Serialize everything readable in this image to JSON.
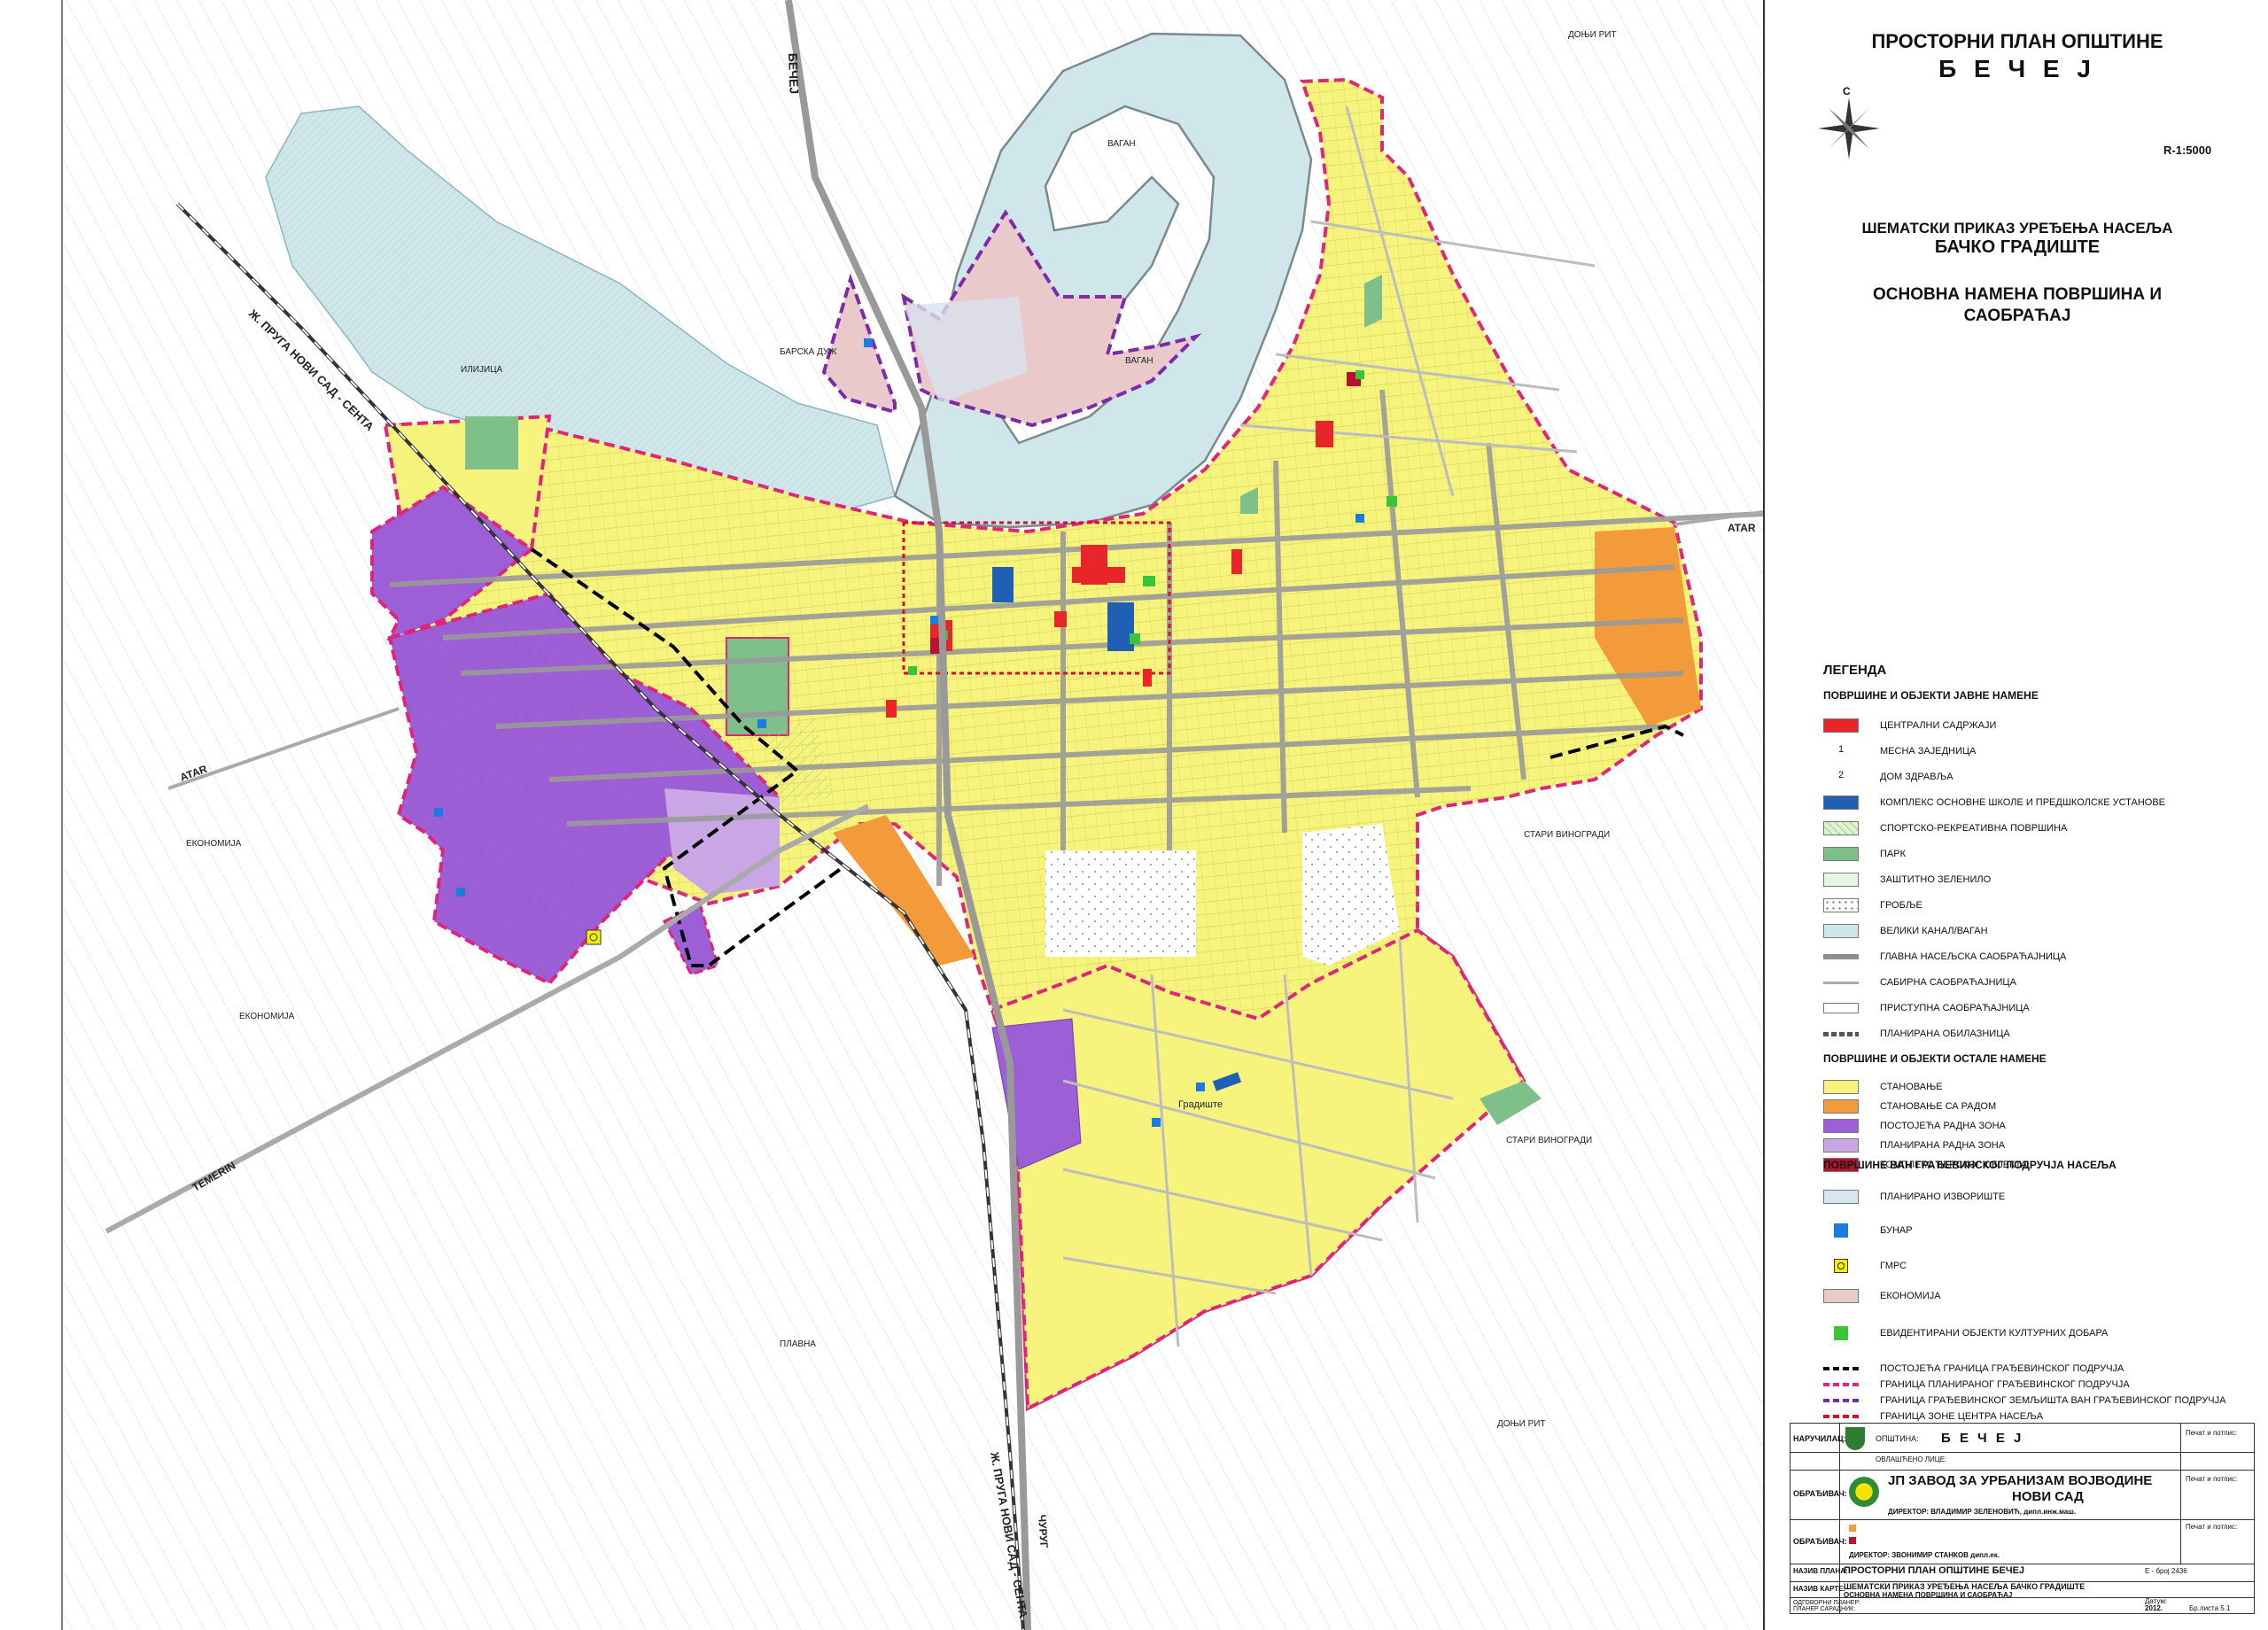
{
  "title": {
    "line1": "ПРОСТОРНИ ПЛАН ОПШТИНЕ",
    "line2": "Б Е Ч Е Ј",
    "north": "С",
    "scale": "R-1:5000",
    "subtitle1": "ШЕМАТСКИ ПРИКАЗ УРЕЂЕЊА НАСЕЉА",
    "subtitle2": "БАЧКО ГРАДИШТЕ",
    "subtitle3": "ОСНОВНА НАМЕНА ПОВРШИНА И",
    "subtitle4": "САОБРАЋАЈ"
  },
  "legend": {
    "heading": "ЛЕГЕНДА",
    "section1": "ПОВРШИНЕ И ОБЈЕКТИ ЈАВНЕ НАМЕНЕ",
    "section2": "ПОВРШИНЕ И ОБЈЕКТИ ОСТАЛЕ НАМЕНЕ",
    "section3": "ПОВРШИНЕ ВАН ГРАЂЕВИНСКОГ ПОДРУЧЈА НАСЕЉА",
    "items_public": [
      {
        "label": "ЦЕНТРАЛНИ САДРЖАЈИ",
        "color": "#e8262a",
        "kind": "fill"
      },
      {
        "label": "МЕСНА ЗАЈЕДНИЦА",
        "marker": "1",
        "kind": "num"
      },
      {
        "label": "ДОМ ЗДРАВЉА",
        "marker": "2",
        "kind": "num"
      },
      {
        "label": "КОМПЛЕКС ОСНОВНЕ ШКОЛЕ И ПРЕДШКОЛСКЕ УСТАНОВЕ",
        "color": "#1f5fb4",
        "kind": "fill"
      },
      {
        "label": "СПОРТСКО-РЕКРЕАТИВНА ПОВРШИНА",
        "color": "#dff3d0",
        "kind": "hatch"
      },
      {
        "label": "ПАРК",
        "color": "#7fbf8a",
        "kind": "fill"
      },
      {
        "label": "ЗАШТИТНО ЗЕЛЕНИЛО",
        "color": "#eaf4e6",
        "kind": "fill"
      },
      {
        "label": "ГРОБЉЕ",
        "color": "#ffffff",
        "kind": "dots"
      },
      {
        "label": "ВЕЛИКИ КАНАЛ/ВАГАН",
        "color": "#cfe6ea",
        "kind": "fill"
      },
      {
        "label": "ГЛАВНА НАСЕЉСКА САОБРАЋАЈНИЦА",
        "kind": "line-thick"
      },
      {
        "label": "САБИРНА САОБРАЋАЈНИЦА",
        "kind": "line-mid"
      },
      {
        "label": "ПРИСТУПНА САОБРАЋАЈНИЦА",
        "kind": "line-thin"
      },
      {
        "label": "ПЛАНИРАНА ОБИЛАЗНИЦА",
        "kind": "line-dash"
      }
    ],
    "items_other": [
      {
        "label": "СТАНОВАЊЕ",
        "color": "#f7f47e"
      },
      {
        "label": "СТАНОВАЊЕ СА РАДОМ",
        "color": "#f39b3a"
      },
      {
        "label": "ПОСТОЈЕЋА РАДНА ЗОНА",
        "color": "#9d5fd6"
      },
      {
        "label": "ПЛАНИРАНА РАДНА ЗОНА",
        "color": "#c9a6e4"
      },
      {
        "label": "КОМПЛЕКС ВЕРСКОГ ОБЈЕКТА",
        "color": "#b5122f"
      }
    ],
    "items_outside": [
      {
        "label": "ПЛАНИРАНО ИЗВОРИШТЕ",
        "color": "#d7e7ef",
        "kind": "fill"
      },
      {
        "label": "БУНАР",
        "color": "#1a7be0",
        "kind": "square"
      },
      {
        "label": "ГМРС",
        "color": "#f5f000",
        "kind": "gmrs"
      },
      {
        "label": "ЕКОНОМИЈА",
        "color": "#e9c9c9",
        "kind": "fill"
      },
      {
        "label": "ЕВИДЕНТИРАНИ ОБЈЕКТИ КУЛТУРНИХ ДОБАРА",
        "color": "#3ac43a",
        "kind": "square"
      }
    ],
    "items_bounds": [
      {
        "label": "ПОСТОЈЕЋА ГРАНИЦА ГРАЂЕВИНСКОГ ПОДРУЧЈА",
        "color": "#000000"
      },
      {
        "label": "ГРАНИЦА ПЛАНИРАНОГ ГРАЂЕВИНСКОГ ПОДРУЧЈА",
        "color": "#e0247a"
      },
      {
        "label": "ГРАНИЦА ГРАЂЕВИНСКОГ ЗЕМЉИШТА ВАН ГРАЂЕВИНСКОГ ПОДРУЧЈА",
        "color": "#7d2aa8"
      },
      {
        "label": "ГРАНИЦА ЗОНЕ ЦЕНТРА НАСЕЉА",
        "color": "#d0112b"
      }
    ]
  },
  "titleblock": {
    "client_label": "НАРУЧИЛАЦ:",
    "municipality_label": "ОПШТИНА:",
    "municipality": "Б Е Ч Е Ј",
    "authorized_label": "ОВЛАШЋЕНО ЛИЦЕ:",
    "sign_label": "Печат и потпис:",
    "maker_label": "ОБРАЂИВАЧ:",
    "institute1": "ЈП ЗАВОД ЗА УРБАНИЗАМ ВОЈВОДИНЕ",
    "institute2": "НОВИ САД",
    "director_label": "ДИРЕКТОР: ВЛАДИМИР ЗЕЛЕНОВИЋ, дипл.инж.маш.",
    "maker2_label": "ОБРАЂИВАЧ:",
    "director2_label": "ДИРЕКТОР: ЗВОНИМИР СТАНКОВ дипл.ек.",
    "plan_label": "НАЗИВ ПЛАНА:",
    "plan_name": "ПРОСТОРНИ ПЛАН ОПШТИНЕ БЕЧЕЈ",
    "plan_no": "Е - број 2436",
    "sheet_label": "НАЗИВ КАРТЕ:",
    "sheet_name1": "ШЕМАТСКИ ПРИКАЗ УРЕЂЕЊА НАСЕЉА БАЧКО ГРАДИШТЕ",
    "sheet_name2": "ОСНОВНА НАМЕНА ПОВРШИНА И САОБРАЋАЈ",
    "responsible_label": "ОДГОВОРНИ ПЛАНЕР:",
    "planners_label": "ПЛАНЕР САРАДНИК:",
    "date_label": "Датум:",
    "date": "2012.",
    "sheet_no": "Бр.листа 5.1"
  },
  "map_labels": {
    "road_north": "БЕЧЕЈ",
    "rail_left": "Ж. ПРУГА НОВИ САД - СЕНТА",
    "rail_bottom": "Ж. ПРУГА НОВИ САД - СЕНТА",
    "atar_left": "ATAR",
    "atar_right": "ATAR",
    "temerin": "TEMERIN",
    "curug": "ЧУРУГ",
    "vagan1": "ВАГАН",
    "vagan2": "ВАГАН",
    "ekonomija1": "ЕКОНОМИЈА",
    "ekonomija2": "ЕКОНОМИЈА",
    "ilijica": "ИЛИЈИЦА",
    "plavna": "ПЛАВНА",
    "stari_vinogradi1": "СТАРИ ВИНОГРАДИ",
    "stari_vinogradi2": "СТАРИ ВИНОГРАДИ",
    "donji_rit1": "ДОЊИ РИТ",
    "donji_rit2": "ДОЊИ РИТ",
    "barska_dug": "БАРСКА ДУЖ",
    "gradiste": "Градиште"
  }
}
